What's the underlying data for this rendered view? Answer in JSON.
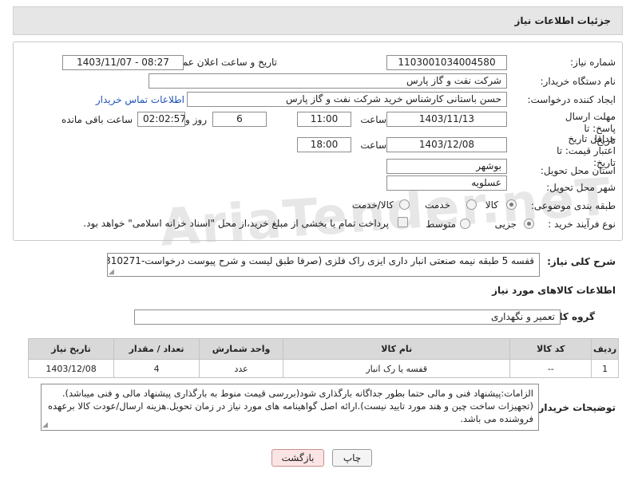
{
  "header": {
    "title": "جزئیات اطلاعات نیاز"
  },
  "fields": {
    "need_number_label": "شماره نیاز:",
    "need_number": "1103001034004580",
    "announce_label": "تاریخ و ساعت اعلان عمومی:",
    "announce_value": "1403/11/07 - 08:27",
    "buyer_org_label": "نام دستگاه خریدار:",
    "buyer_org": "شرکت نفت و گاز پارس",
    "requester_label": "ایجاد کننده درخواست:",
    "requester": "حسن باستانی کارشناس خرید شرکت نفت و گاز پارس",
    "buyer_contact_link": "اطلاعات تماس خریدار",
    "deadline_label": "مهلت ارسال پاسخ: تا تاریخ:",
    "deadline_date": "1403/11/13",
    "time_label": "ساعت",
    "deadline_time": "11:00",
    "days_value": "6",
    "days_label": "روز و",
    "remaining_time": "02:02:57",
    "remaining_label": "ساعت باقی مانده",
    "min_valid_label": "حداقل تاریخ اعتبار قیمت: تا تاریخ:",
    "min_valid_date": "1403/12/08",
    "min_valid_time": "18:00",
    "province_label": "استان محل تحویل:",
    "province": "بوشهر",
    "city_label": "شهر محل تحویل:",
    "city": "عسلویه",
    "category_label": "طبقه بندی موضوعی:",
    "category_options": [
      "کالا",
      "خدمت",
      "کالا/خدمت"
    ],
    "category_selected": "کالا",
    "process_label": "نوع فرآیند خرید :",
    "process_options": [
      "جزیی",
      "متوسط"
    ],
    "process_selected": "جزیی",
    "payment_note": "پرداخت تمام یا بخشی از مبلغ خرید،از محل \"اسناد خزانه اسلامی\" خواهد بود."
  },
  "description": {
    "label": "شرح کلی نیاز:",
    "text": "قفسه 5 طبقه نیمه صنعتی انبار داری ایزی راک فلزی (صرفا طبق لیست و شرح پیوست درخواست-0310271)"
  },
  "goods": {
    "section_title": "اطلاعات کالاهای مورد نیاز",
    "group_label": "گروه کالا:",
    "group_value": "تعمیر و نگهداری",
    "columns": [
      "ردیف",
      "کد کالا",
      "نام کالا",
      "واحد شمارش",
      "تعداد / مقدار",
      "تاریخ نیاز"
    ],
    "rows": [
      {
        "row": "1",
        "code": "--",
        "name": "قفسه یا رک انبار",
        "unit": "عدد",
        "qty": "4",
        "date": "1403/12/08"
      }
    ]
  },
  "buyer_notes": {
    "label": "توضیحات خریدار:",
    "text": "الزامات:پیشنهاد فنی و مالی حتما  بطور جداگانه بارگذاری شود(بررسی قیمت منوط به بارگذاری پیشنهاد مالی و فنی میباشد).(تجهیزات ساخت چین و هند مورد تایید نیست).ارائه اصل گواهینامه های مورد نیاز در زمان تحویل.هزینه ارسال/عودت کالا برعهده فروشنده می باشد."
  },
  "buttons": {
    "print": "چاپ",
    "back": "بازگشت"
  },
  "watermark": "AriaTender.neT"
}
